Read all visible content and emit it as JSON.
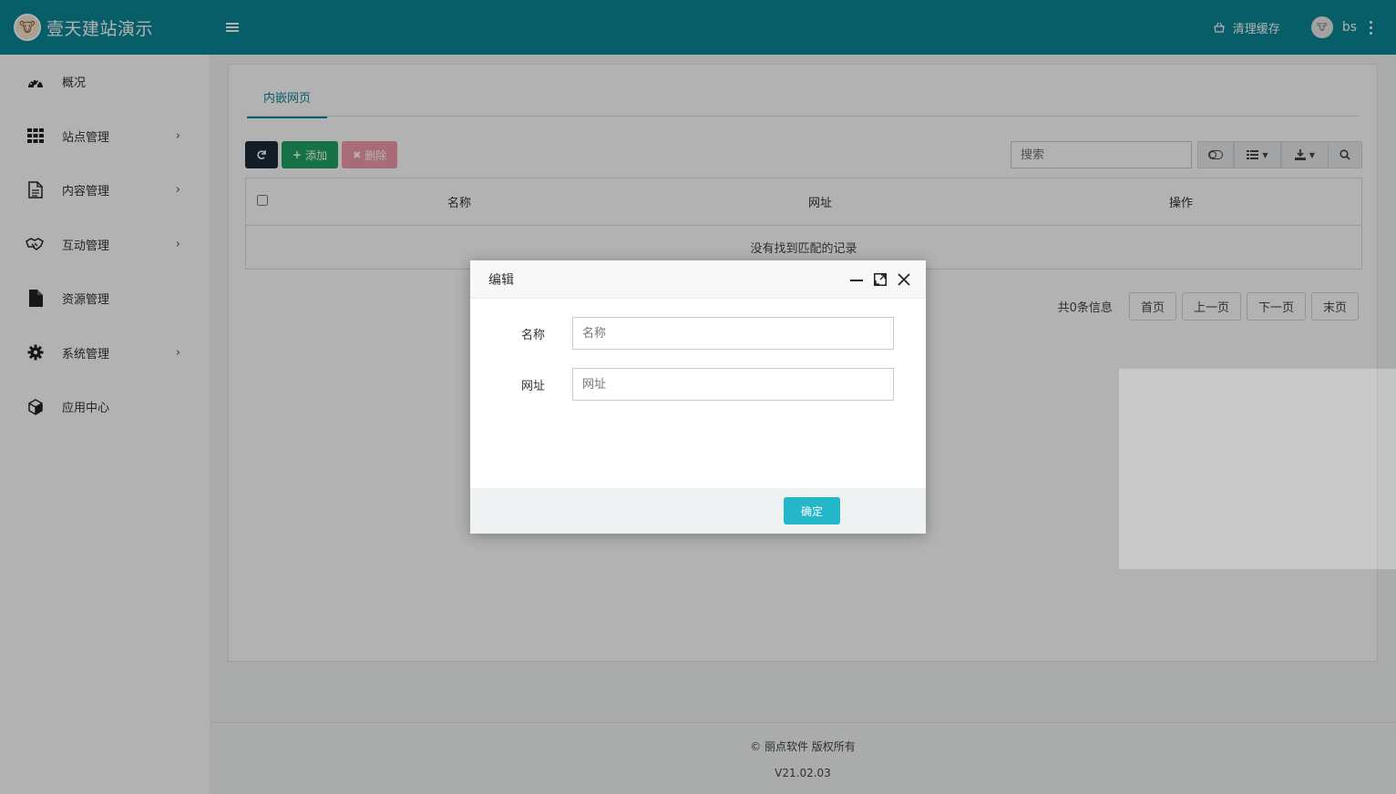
{
  "header": {
    "brand_name": "壹天建站演示",
    "clear_cache_label": "清理缓存",
    "user_name": "bs"
  },
  "sidebar": {
    "items": [
      {
        "label": "概况",
        "icon": "dashboard-icon",
        "has_arrow": false
      },
      {
        "label": "站点管理",
        "icon": "grid-icon",
        "has_arrow": true
      },
      {
        "label": "内容管理",
        "icon": "document-icon",
        "has_arrow": true
      },
      {
        "label": "互动管理",
        "icon": "handshake-icon",
        "has_arrow": true
      },
      {
        "label": "资源管理",
        "icon": "file-icon",
        "has_arrow": false
      },
      {
        "label": "系统管理",
        "icon": "gear-icon",
        "has_arrow": true
      },
      {
        "label": "应用中心",
        "icon": "cube-icon",
        "has_arrow": false
      }
    ]
  },
  "tabs": [
    {
      "label": "内嵌网页"
    }
  ],
  "toolbar": {
    "add_label": "添加",
    "delete_label": "删除",
    "search_placeholder": "搜索"
  },
  "table": {
    "columns": [
      "名称",
      "网址",
      "操作"
    ],
    "empty_message": "没有找到匹配的记录"
  },
  "pagination": {
    "info": "共0条信息",
    "first": "首页",
    "prev": "上一页",
    "next": "下一页",
    "last": "末页"
  },
  "footer": {
    "copyright": "© 丽点软件 版权所有",
    "version": "V21.02.03"
  },
  "modal": {
    "title": "编辑",
    "fields": [
      {
        "label": "名称",
        "placeholder": "名称",
        "value": ""
      },
      {
        "label": "网址",
        "placeholder": "网址",
        "value": ""
      }
    ],
    "confirm_label": "确定"
  },
  "colors": {
    "header": "#0b8796",
    "primary_dark": "#1b2a3a",
    "success": "#1ea463",
    "danger": "#f07a8e",
    "confirm": "#23b7c9"
  }
}
